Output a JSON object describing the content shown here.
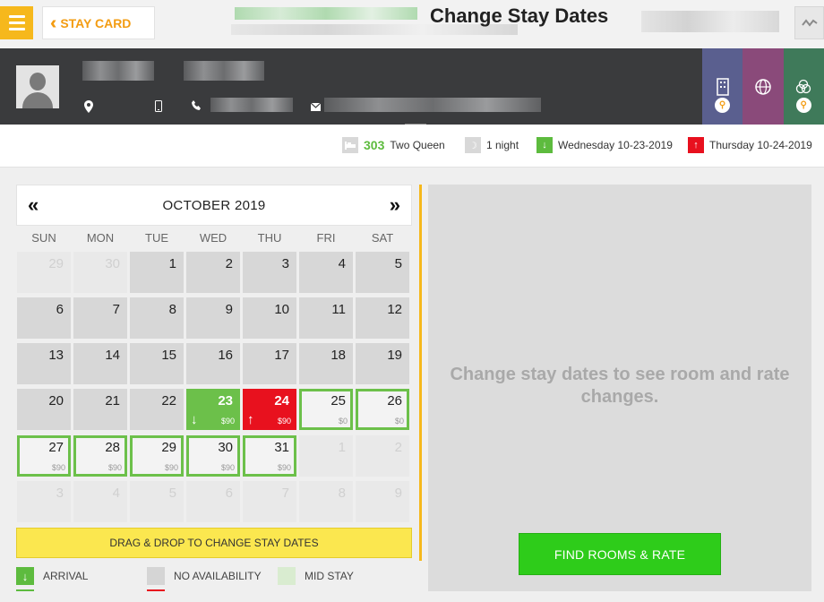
{
  "header": {
    "menu_icon": "hamburger-icon",
    "stay_card_label": "STAY CARD",
    "page_title": "Change Stay Dates"
  },
  "summary": {
    "room_number": "303",
    "room_type": "Two Queen",
    "nights": "1 night",
    "arrival": "Wednesday 10-23-2019",
    "departure": "Thursday 10-24-2019"
  },
  "calendar": {
    "month_title": "OCTOBER 2019",
    "prev_icon": "«",
    "next_icon": "»",
    "weekdays": [
      "SUN",
      "MON",
      "TUE",
      "WED",
      "THU",
      "FRI",
      "SAT"
    ],
    "days": [
      {
        "num": "29",
        "state": "other"
      },
      {
        "num": "30",
        "state": "other"
      },
      {
        "num": "1",
        "state": "noavail"
      },
      {
        "num": "2",
        "state": "noavail"
      },
      {
        "num": "3",
        "state": "noavail"
      },
      {
        "num": "4",
        "state": "noavail"
      },
      {
        "num": "5",
        "state": "noavail"
      },
      {
        "num": "6",
        "state": "noavail"
      },
      {
        "num": "7",
        "state": "noavail"
      },
      {
        "num": "8",
        "state": "noavail"
      },
      {
        "num": "9",
        "state": "noavail"
      },
      {
        "num": "10",
        "state": "noavail"
      },
      {
        "num": "11",
        "state": "noavail"
      },
      {
        "num": "12",
        "state": "noavail"
      },
      {
        "num": "13",
        "state": "noavail"
      },
      {
        "num": "14",
        "state": "noavail"
      },
      {
        "num": "15",
        "state": "noavail"
      },
      {
        "num": "16",
        "state": "noavail"
      },
      {
        "num": "17",
        "state": "noavail"
      },
      {
        "num": "18",
        "state": "noavail"
      },
      {
        "num": "19",
        "state": "noavail"
      },
      {
        "num": "20",
        "state": "noavail"
      },
      {
        "num": "21",
        "state": "noavail"
      },
      {
        "num": "22",
        "state": "noavail"
      },
      {
        "num": "23",
        "state": "arrival",
        "price": "$90"
      },
      {
        "num": "24",
        "state": "departure",
        "price": "$90"
      },
      {
        "num": "25",
        "state": "avail",
        "price": "$0"
      },
      {
        "num": "26",
        "state": "avail",
        "price": "$0"
      },
      {
        "num": "27",
        "state": "avail",
        "price": "$90"
      },
      {
        "num": "28",
        "state": "avail",
        "price": "$90"
      },
      {
        "num": "29",
        "state": "avail",
        "price": "$90"
      },
      {
        "num": "30",
        "state": "avail",
        "price": "$90"
      },
      {
        "num": "31",
        "state": "avail",
        "price": "$90"
      },
      {
        "num": "1",
        "state": "other"
      },
      {
        "num": "2",
        "state": "other"
      },
      {
        "num": "3",
        "state": "other"
      },
      {
        "num": "4",
        "state": "other"
      },
      {
        "num": "5",
        "state": "other"
      },
      {
        "num": "6",
        "state": "other"
      },
      {
        "num": "7",
        "state": "other"
      },
      {
        "num": "8",
        "state": "other"
      },
      {
        "num": "9",
        "state": "other"
      }
    ],
    "drag_label": "DRAG & DROP TO CHANGE STAY DATES"
  },
  "legend": {
    "arrival": "ARRIVAL",
    "no_availability": "NO AVAILABILITY",
    "mid_stay": "MID STAY"
  },
  "right_panel": {
    "placeholder": "Change stay dates to see room and rate changes.",
    "find_button": "FIND ROOMS & RATE"
  },
  "colors": {
    "accent": "#f6b81c",
    "arrival": "#6cc04a",
    "departure": "#e8111e",
    "find_button": "#2ecc1a"
  }
}
